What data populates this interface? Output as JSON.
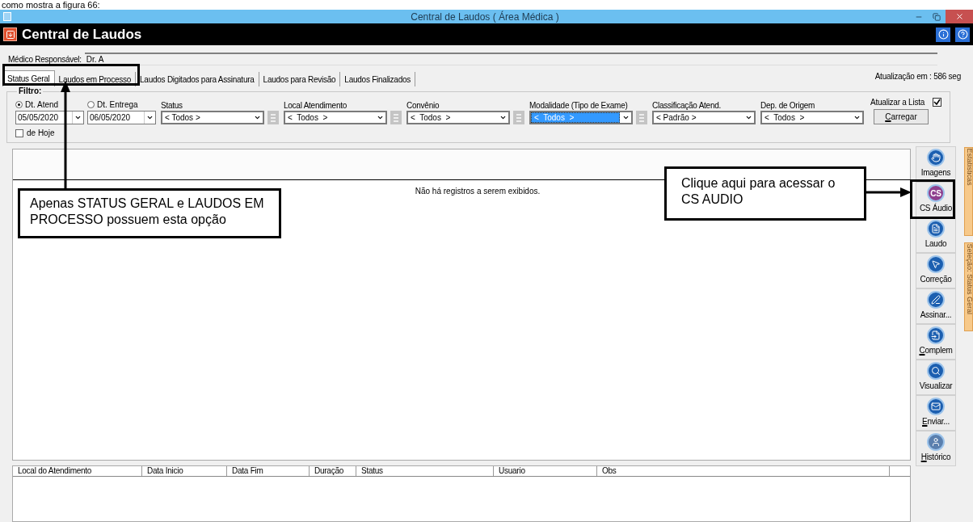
{
  "caption": "como mostra a figura 66:",
  "window": {
    "title": "Central de Laudos ( Área Médica )"
  },
  "header": {
    "title": "Central de Laudos"
  },
  "doctor": {
    "label": "Médico Responsável:",
    "value": "Dr. A"
  },
  "tabs": [
    {
      "label": "Status Geral",
      "selected": true
    },
    {
      "label": "Laudos em Processo",
      "selected": false
    },
    {
      "label": "Laudos Digitados para Assinatura",
      "selected": false
    },
    {
      "label": "Laudos para Revisão",
      "selected": false
    },
    {
      "label": "Laudos Finalizados",
      "selected": false
    }
  ],
  "refresh_info": "Atualização em : 586 seg",
  "filter": {
    "title": "Filtro:",
    "auto_refresh": {
      "label": "Atualizar a Lista",
      "checked": true
    },
    "date_fields": [
      {
        "label": "Dt. Atend",
        "selected": true,
        "value": "05/05/2020"
      },
      {
        "label": "Dt. Entrega",
        "selected": false,
        "value": "06/05/2020"
      }
    ],
    "today": {
      "label": "de Hoje",
      "checked": false
    },
    "selects": [
      {
        "label": "Status",
        "value": "< Todos >",
        "picker": true,
        "focused": false
      },
      {
        "label": "Local Atendimento",
        "value": "<  Todos  >",
        "picker": true,
        "focused": false
      },
      {
        "label": "Convênio",
        "value": "<  Todos  >",
        "picker": true,
        "focused": false
      },
      {
        "label": "Modalidade (Tipo de Exame)",
        "value": "<  Todos  >",
        "picker": true,
        "focused": true
      },
      {
        "label": "Classificação Atend.",
        "value": "< Padrão >",
        "picker": false,
        "focused": false
      },
      {
        "label": "Dep. de Origem",
        "value": "<  Todos  >",
        "picker": false,
        "focused": false
      }
    ],
    "load_button": {
      "label": "Carregar",
      "mnemonic": true
    }
  },
  "grid": {
    "empty_message": "Não há registros a serem exibidos."
  },
  "toolbar": [
    {
      "label": "Imagens",
      "kind": "hand",
      "mnemonic": false
    },
    {
      "label": "CS Áudio",
      "kind": "cs",
      "icon_text": "CS",
      "mnemonic": false
    },
    {
      "label": "Laudo",
      "kind": "document",
      "mnemonic": false
    },
    {
      "label": "Correção",
      "kind": "pointer",
      "mnemonic": false
    },
    {
      "label": "Assinar...",
      "kind": "pen",
      "mnemonic": false
    },
    {
      "label": "Complem",
      "kind": "document-arrow",
      "mnemonic": true
    },
    {
      "label": "Visualizar",
      "kind": "magnifier",
      "mnemonic": false
    },
    {
      "label": "Enviar...",
      "kind": "envelope",
      "mnemonic": true
    },
    {
      "label": "Histórico",
      "kind": "person",
      "mnemonic": true
    }
  ],
  "history_table": {
    "columns": [
      "Local do Atendimento",
      "Data Inicio",
      "Data Fim",
      "Duração",
      "Status",
      "Usuario",
      "Obs"
    ]
  },
  "side_tabs": [
    "Estatísticas",
    "Seleção: Status Geral"
  ],
  "annotations": [
    {
      "text": "Apenas STATUS GERAL e LAUDOS EM PROCESSO possuem esta opção"
    },
    {
      "text": "Clique aqui para acessar o CS AUDIO"
    }
  ]
}
